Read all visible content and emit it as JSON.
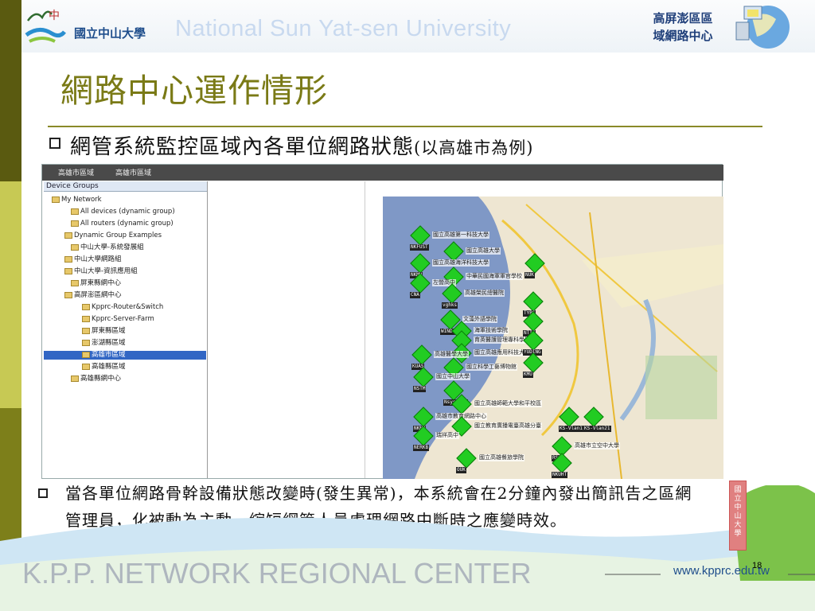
{
  "header": {
    "university_cn": "國立中山大學",
    "university_en": "National Sun Yat-sen University",
    "center_name_line1": "高屏澎區區",
    "center_name_line2": "域網路中心"
  },
  "title": "網路中心運作情形",
  "subtitle_main": "網管系統監控區域內各單位網路狀態",
  "subtitle_paren": "(以高雄市為例)",
  "screenshot": {
    "tabs": [
      "高雄市區域",
      "高雄市區域"
    ],
    "pane_header": "Device Groups",
    "tree": [
      {
        "label": "My Network"
      },
      {
        "label": "All devices (dynamic group)"
      },
      {
        "label": "All routers (dynamic group)"
      },
      {
        "label": "Dynamic Group Examples"
      },
      {
        "label": "中山大學-系統發展組"
      },
      {
        "label": "中山大學網路組"
      },
      {
        "label": "中山大學-資訊應用組"
      },
      {
        "label": "屏東縣網中心"
      },
      {
        "label": "高屏澎區網中心"
      },
      {
        "label": "Kpprc-Router&Switch"
      },
      {
        "label": "Kpprc-Server-Farm"
      },
      {
        "label": "屏東縣區域"
      },
      {
        "label": "澎湖縣區域"
      },
      {
        "label": "高雄市區域",
        "selected": true
      },
      {
        "label": "高雄縣區域"
      },
      {
        "label": "高雄縣網中心"
      }
    ],
    "nodes": [
      {
        "tag": "NKFUST",
        "label": "國立高雄第一科技大學"
      },
      {
        "tag": "",
        "label": "國立高雄大學"
      },
      {
        "tag": "NKMU",
        "label": "國立高雄海洋科技大學"
      },
      {
        "tag": "NUK",
        "label": ""
      },
      {
        "tag": "",
        "label": "中華民國海軍軍官學校"
      },
      {
        "tag": "CNA",
        "label": "左營高中"
      },
      {
        "tag": "vghks",
        "label": "高雄榮民總醫院"
      },
      {
        "tag": "TYBS",
        "label": ""
      },
      {
        "tag": "WIND.GOV",
        "label": "文藻外語學院"
      },
      {
        "tag": "",
        "label": "海軍技術學院"
      },
      {
        "tag": "NTIC",
        "label": ""
      },
      {
        "tag": "",
        "label": "育英醫護管理專科學校"
      },
      {
        "tag": "",
        "label": "國立高雄應用科技大學"
      },
      {
        "tag": "YUDING",
        "label": ""
      },
      {
        "tag": "KUAS",
        "label": "高雄醫學大學"
      },
      {
        "tag": "",
        "label": "國立科學工藝博物館"
      },
      {
        "tag": "KMU",
        "label": ""
      },
      {
        "tag": "NSTM",
        "label": "國立中山大學"
      },
      {
        "tag": "Nsysu-TP",
        "label": ""
      },
      {
        "tag": "",
        "label": "國立高雄師範大學和平校區"
      },
      {
        "tag": "NKNU",
        "label": "高雄市教育網路中心"
      },
      {
        "tag": "",
        "label": "國立教育廣播電臺高雄分臺"
      },
      {
        "tag": "KS-Vlan11",
        "label": ""
      },
      {
        "tag": "KS-Vlan21",
        "label": ""
      },
      {
        "tag": "NERKB",
        "label": "瑞祥高中"
      },
      {
        "tag": "RSSB",
        "label": "高雄市立空中大學"
      },
      {
        "tag": "OUK",
        "label": "國立高雄餐旅學院"
      },
      {
        "tag": "NKUHT",
        "label": ""
      }
    ]
  },
  "note_text": "當各單位網路骨幹設備狀態改變時(發生異常)，本系統會在2分鐘內發出簡訊告之區網管理員，化被動為主動，縮短網管人員處理網路中斷時之應變時效。",
  "footer": {
    "center_en": "K.P.P. NETWORK REGIONAL CENTER",
    "url": "www.kpprc.edu.tw",
    "page_number": "18",
    "tower_text": "國立中山大學"
  },
  "colors": {
    "title": "#7a7a16",
    "accent": "#1f4e8c",
    "node": "#22cc22"
  }
}
